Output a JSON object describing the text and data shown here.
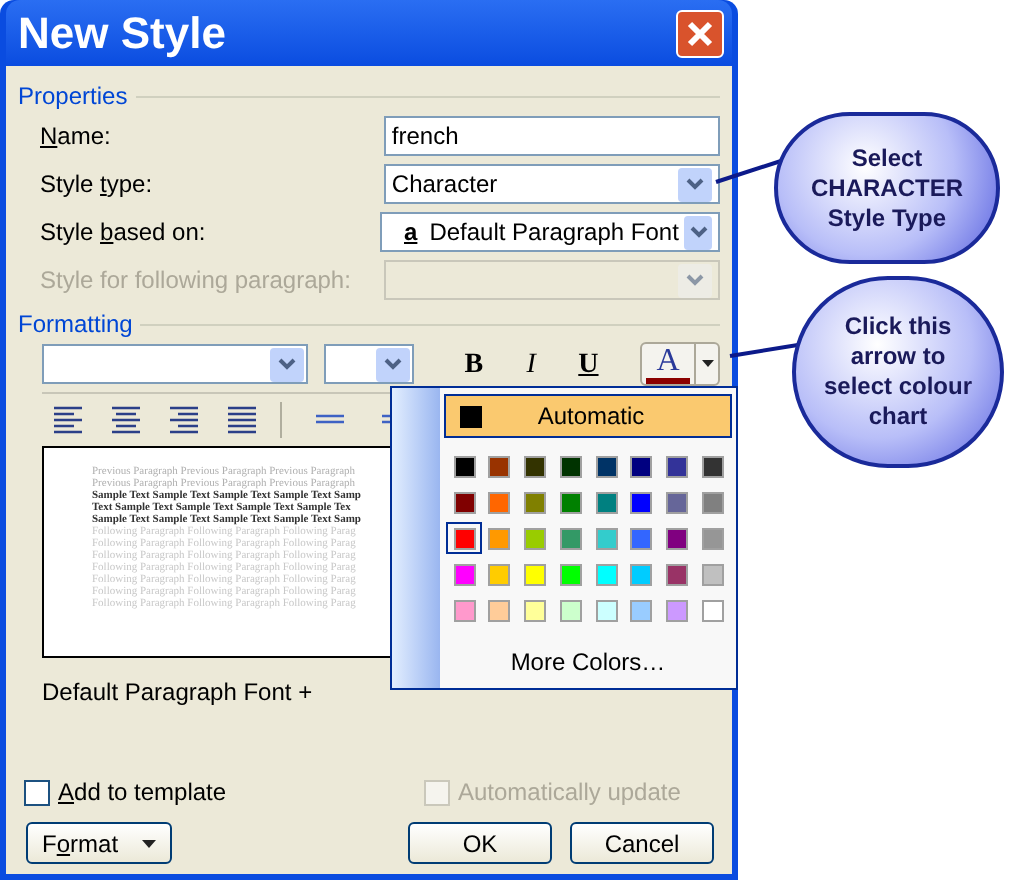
{
  "window": {
    "title": "New Style"
  },
  "properties": {
    "heading": "Properties",
    "fields": [
      {
        "kind": "text",
        "label": {
          "key": "N",
          "post": "ame:"
        },
        "value": "french",
        "disabled": false
      },
      {
        "kind": "dropdown",
        "label": {
          "pre": "Style ",
          "key": "t",
          "post": "ype:"
        },
        "value": "Character",
        "disabled": false
      },
      {
        "kind": "dropdown",
        "label": {
          "pre": "Style ",
          "key": "b",
          "post": "ased on:"
        },
        "value": "Default Paragraph Font",
        "value_icon": "a",
        "disabled": false
      },
      {
        "kind": "dropdown",
        "label": {
          "pre": "Style for following paragraph:"
        },
        "disabled": true
      }
    ]
  },
  "formatting": {
    "heading": "Formatting",
    "toolbar": [
      {
        "kind": "combo"
      },
      {
        "kind": "combo_small"
      },
      {
        "kind": "bold",
        "text": "B"
      },
      {
        "kind": "italic",
        "text": "I"
      },
      {
        "kind": "underline",
        "text": "U"
      },
      {
        "kind": "font_color",
        "text": "A"
      }
    ]
  },
  "preview": {
    "previous": [
      "Previous Paragraph Previous Paragraph Previous Paragraph",
      "Previous Paragraph Previous Paragraph Previous Paragraph"
    ],
    "sample": [
      "Sample Text Sample Text Sample Text Sample Text Samp",
      "Text Sample Text Sample Text Sample Text Sample Tex",
      "Sample Text Sample Text Sample Text Sample Text Samp"
    ],
    "following": [
      "Following Paragraph Following Paragraph Following Parag",
      "Following Paragraph Following Paragraph Following Parag",
      "Following Paragraph Following Paragraph Following Parag",
      "Following Paragraph Following Paragraph Following Parag",
      "Following Paragraph Following Paragraph Following Parag",
      "Following Paragraph Following Paragraph Following Parag",
      "Following Paragraph Following Paragraph Following Parag"
    ]
  },
  "description": "Default Paragraph Font +",
  "color_menu": {
    "automatic": "Automatic",
    "swatches": [
      {
        "color": "#000000",
        "selected": false
      },
      {
        "color": "#993300",
        "selected": false
      },
      {
        "color": "#333300",
        "selected": false
      },
      {
        "color": "#003300",
        "selected": false
      },
      {
        "color": "#003366",
        "selected": false
      },
      {
        "color": "#000080",
        "selected": false
      },
      {
        "color": "#333399",
        "selected": false
      },
      {
        "color": "#333333",
        "selected": false
      },
      {
        "color": "#800000",
        "selected": false
      },
      {
        "color": "#ff6600",
        "selected": false
      },
      {
        "color": "#808000",
        "selected": false
      },
      {
        "color": "#008000",
        "selected": false
      },
      {
        "color": "#008080",
        "selected": false
      },
      {
        "color": "#0000ff",
        "selected": false
      },
      {
        "color": "#666699",
        "selected": false
      },
      {
        "color": "#808080",
        "selected": false
      },
      {
        "color": "#ff0000",
        "selected": true
      },
      {
        "color": "#ff9900",
        "selected": false
      },
      {
        "color": "#99cc00",
        "selected": false
      },
      {
        "color": "#339966",
        "selected": false
      },
      {
        "color": "#33cccc",
        "selected": false
      },
      {
        "color": "#3366ff",
        "selected": false
      },
      {
        "color": "#800080",
        "selected": false
      },
      {
        "color": "#969696",
        "selected": false
      },
      {
        "color": "#ff00ff",
        "selected": false
      },
      {
        "color": "#ffcc00",
        "selected": false
      },
      {
        "color": "#ffff00",
        "selected": false
      },
      {
        "color": "#00ff00",
        "selected": false
      },
      {
        "color": "#00ffff",
        "selected": false
      },
      {
        "color": "#00ccff",
        "selected": false
      },
      {
        "color": "#993366",
        "selected": false
      },
      {
        "color": "#c0c0c0",
        "selected": false
      },
      {
        "color": "#ff99cc",
        "selected": false
      },
      {
        "color": "#ffcc99",
        "selected": false
      },
      {
        "color": "#ffff99",
        "selected": false
      },
      {
        "color": "#ccffcc",
        "selected": false
      },
      {
        "color": "#ccffff",
        "selected": false
      },
      {
        "color": "#99ccff",
        "selected": false
      },
      {
        "color": "#cc99ff",
        "selected": false
      },
      {
        "color": "#ffffff",
        "selected": false
      }
    ],
    "more": "More Colors…"
  },
  "checkboxes": [
    {
      "label": {
        "key": "A",
        "post": "dd to template"
      },
      "checked": false,
      "disabled": false
    },
    {
      "label": {
        "pre": "Automatically update"
      },
      "checked": false,
      "disabled": true
    }
  ],
  "buttons": [
    {
      "kind": "menu",
      "label": {
        "pre": "F",
        "key": "o",
        "post": "rmat"
      }
    },
    {
      "kind": "plain",
      "label": {
        "pre": "OK"
      }
    },
    {
      "kind": "plain",
      "label": {
        "pre": "Cancel"
      }
    }
  ],
  "callouts": [
    {
      "text": "Select CHARACTER Style Type"
    },
    {
      "text": "Click this arrow to select colour chart"
    }
  ]
}
